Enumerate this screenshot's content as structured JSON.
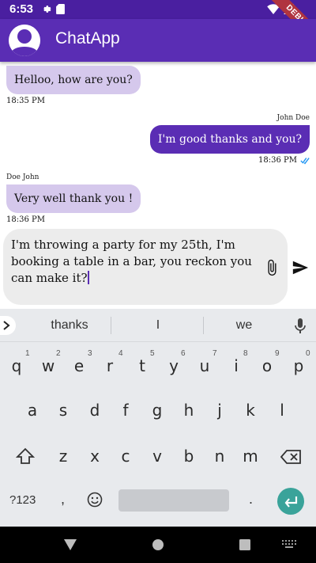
{
  "status_bar": {
    "time": "6:53",
    "debug_label": "DEBUG"
  },
  "app_bar": {
    "title": "ChatApp",
    "color": "#5a2db4"
  },
  "messages": [
    {
      "direction": "in",
      "text": "Helloo, how are you?",
      "time": "18:35 PM"
    },
    {
      "direction": "out",
      "sender": "John Doe",
      "text": "I'm good thanks and you?",
      "time": "18:36 PM"
    },
    {
      "direction": "in",
      "sender": "Doe John",
      "text": "Very well thank you !",
      "time": "18:36 PM"
    }
  ],
  "composer": {
    "value": "I'm throwing a party for my 25th, I'm booking a table in a bar, you reckon you can make it?"
  },
  "keyboard": {
    "suggestions": [
      "thanks",
      "I",
      "we"
    ],
    "row1": [
      "q",
      "w",
      "e",
      "r",
      "t",
      "y",
      "u",
      "i",
      "o",
      "p"
    ],
    "row1_hints": [
      "1",
      "2",
      "3",
      "4",
      "5",
      "6",
      "7",
      "8",
      "9",
      "0"
    ],
    "row2": [
      "a",
      "s",
      "d",
      "f",
      "g",
      "h",
      "j",
      "k",
      "l"
    ],
    "row3": [
      "z",
      "x",
      "c",
      "v",
      "b",
      "n",
      "m"
    ],
    "symbols_key": "?123",
    "comma_key": ",",
    "period_key": ".",
    "enter_color": "#3aa39a"
  }
}
